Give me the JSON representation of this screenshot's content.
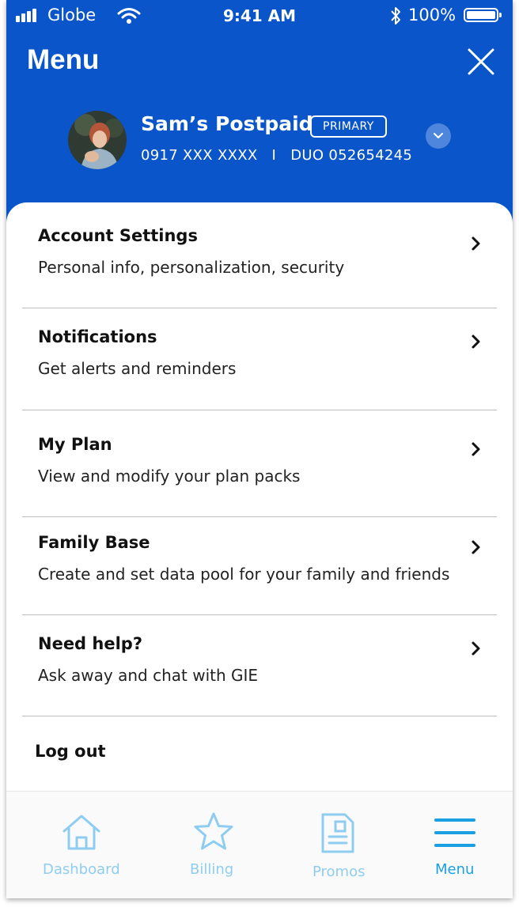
{
  "status_bar": {
    "carrier": "Globe",
    "time": "9:41 AM",
    "battery": "100%"
  },
  "header": {
    "title": "Menu"
  },
  "account": {
    "name": "Sam’s Postpaid",
    "badge": "PRIMARY",
    "numbers": "0917 XXX XXXX   I   DUO 052654245"
  },
  "menu_items": [
    {
      "title": "Account Settings",
      "subtitle": "Personal info, personalization, security"
    },
    {
      "title": "Notifications",
      "subtitle": "Get alerts and reminders"
    },
    {
      "title": "My Plan",
      "subtitle": "View and modify your plan packs"
    },
    {
      "title": "Family Base",
      "subtitle": "Create and set data pool for your family and friends"
    },
    {
      "title": "Need help?",
      "subtitle": "Ask away and chat with GIE"
    }
  ],
  "logout_label": "Log out",
  "tab_bar": {
    "tabs": [
      {
        "label": "Dashboard",
        "icon": "home-icon",
        "active": false
      },
      {
        "label": "Billing",
        "icon": "star-icon",
        "active": false
      },
      {
        "label": "Promos",
        "icon": "document-icon",
        "active": false
      },
      {
        "label": "Menu",
        "icon": "hamburger-icon",
        "active": true
      }
    ]
  },
  "colors": {
    "header_blue": "#0a55c9",
    "tab_inactive": "#8fcdf0",
    "tab_active": "#1a9fe0"
  }
}
